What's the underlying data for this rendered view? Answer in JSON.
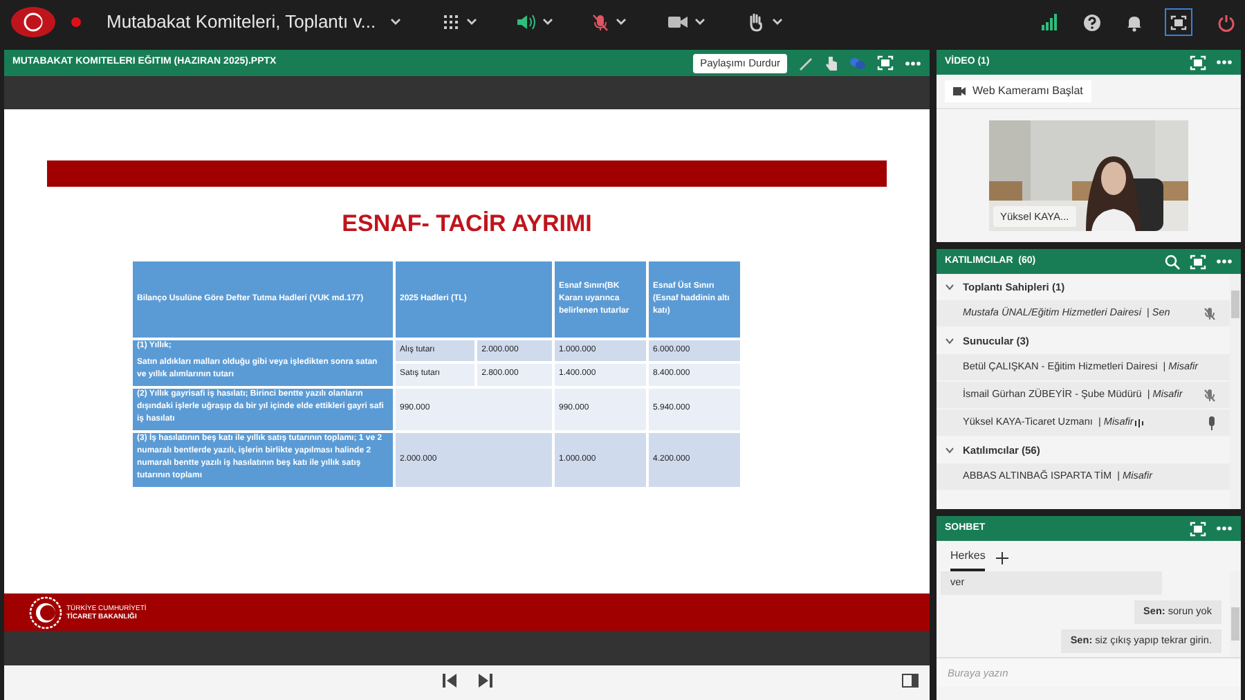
{
  "top_bar": {
    "title": "Mutabakat Komiteleri, Toplantı v..."
  },
  "share_pod": {
    "title": "MUTABAKAT KOMITELERI EĞITIM (HAZIRAN 2025).PPTX",
    "stop_button": "Paylaşımı Durdur",
    "slide": {
      "title": "ESNAF- TACİR AYRIMI",
      "table": {
        "header": [
          "Bilanço Usulüne Göre Defter Tutma Hadleri (VUK md.177)",
          "2025 Hadleri (TL)",
          "Esnaf Sınırı(BK Kararı uyarınca belirlenen tutarlar",
          "Esnaf Üst Sınırı (Esnaf haddinin altı katı)"
        ],
        "rows": [
          {
            "kind": "split",
            "label": [
              "(1) Yıllık;",
              "Satın aldıkları malları olduğu gibi veya işledikten sonra satan ve yıllık alımlarının tutarı"
            ],
            "subrows": [
              {
                "label": "Alış tutarı",
                "value": "2.000.000",
                "esnaf": "1.000.000",
                "upper": "6.000.000"
              },
              {
                "label": "Satış tutarı",
                "value": "2.800.000",
                "esnaf": "1.400.000",
                "upper": "8.400.000"
              }
            ]
          },
          {
            "kind": "merged",
            "label": [
              "(2) Yıllık gayrisafi iş hasılatı; Birinci bentte yazılı olanların dışındaki işlerle uğraşıp da bir yıl içinde elde ettikleri gayri safi iş hasılatı"
            ],
            "value": "990.000",
            "esnaf": "990.000",
            "upper": "5.940.000"
          },
          {
            "kind": "merged",
            "label": [
              "(3) İş hasılatının beş katı ile yıllık satış tutarının toplamı; 1 ve 2 numaralı bentlerde yazılı, işlerin birlikte yapılması halinde 2 numaralı bentte yazılı iş hasılatının beş katı ile yıllık satış tutarının toplamı"
            ],
            "value": "2.000.000",
            "esnaf": "1.000.000",
            "upper": "4.200.000"
          }
        ]
      },
      "footer_org": [
        "TÜRKİYE CUMHURİYETİ",
        "TİCARET BAKANLIĞI"
      ]
    }
  },
  "video_pod": {
    "title": "VİDEO (1)",
    "webcam_button": "Web Kameramı Başlat",
    "name_tag": "Yüksel KAYA..."
  },
  "attendees_pod": {
    "title": "KATILIMCILAR  (60)",
    "groups": [
      {
        "label": "Toplantı Sahipleri (1)",
        "expanded": true,
        "people": [
          {
            "name": "Mustafa ÜNAL/Eğitim Hizmetleri Dairesi",
            "separator": "|",
            "role": "Sen",
            "self": true,
            "speaking": false,
            "muted": true
          }
        ]
      },
      {
        "label": "Sunucular (3)",
        "expanded": true,
        "people": [
          {
            "name": "Betül ÇALIŞKAN - Eğitim Hizmetleri Dairesi",
            "separator": "|",
            "role": "Misafir",
            "self": false,
            "speaking": false,
            "muted": false
          },
          {
            "name": "İsmail Gürhan ZÜBEYİR - Şube Müdürü",
            "separator": "|",
            "role": "Misafir",
            "self": false,
            "speaking": false,
            "muted": true
          },
          {
            "name": "Yüksel KAYA-Ticaret Uzmanı",
            "separator": "|",
            "role": "Misafir",
            "self": false,
            "speaking": true,
            "muted": false
          }
        ]
      },
      {
        "label": "Katılımcılar (56)",
        "expanded": true,
        "people": [
          {
            "name": "ABBAS ALTINBAĞ ISPARTA TİM",
            "separator": "|",
            "role": "Misafir",
            "self": false,
            "speaking": false,
            "muted": false
          }
        ]
      }
    ]
  },
  "chat_pod": {
    "title": "SOHBET",
    "tabs": [
      {
        "label": "Herkes",
        "selected": true
      }
    ],
    "messages": [
      {
        "text": "ver",
        "mine": false
      },
      {
        "sender": "Sen:",
        "text": "sorun yok",
        "mine": true
      },
      {
        "sender": "Sen:",
        "text": "siz çıkış yapıp tekrar girin.",
        "mine": true
      }
    ],
    "input": {
      "placeholder": "Buraya yazın"
    }
  }
}
